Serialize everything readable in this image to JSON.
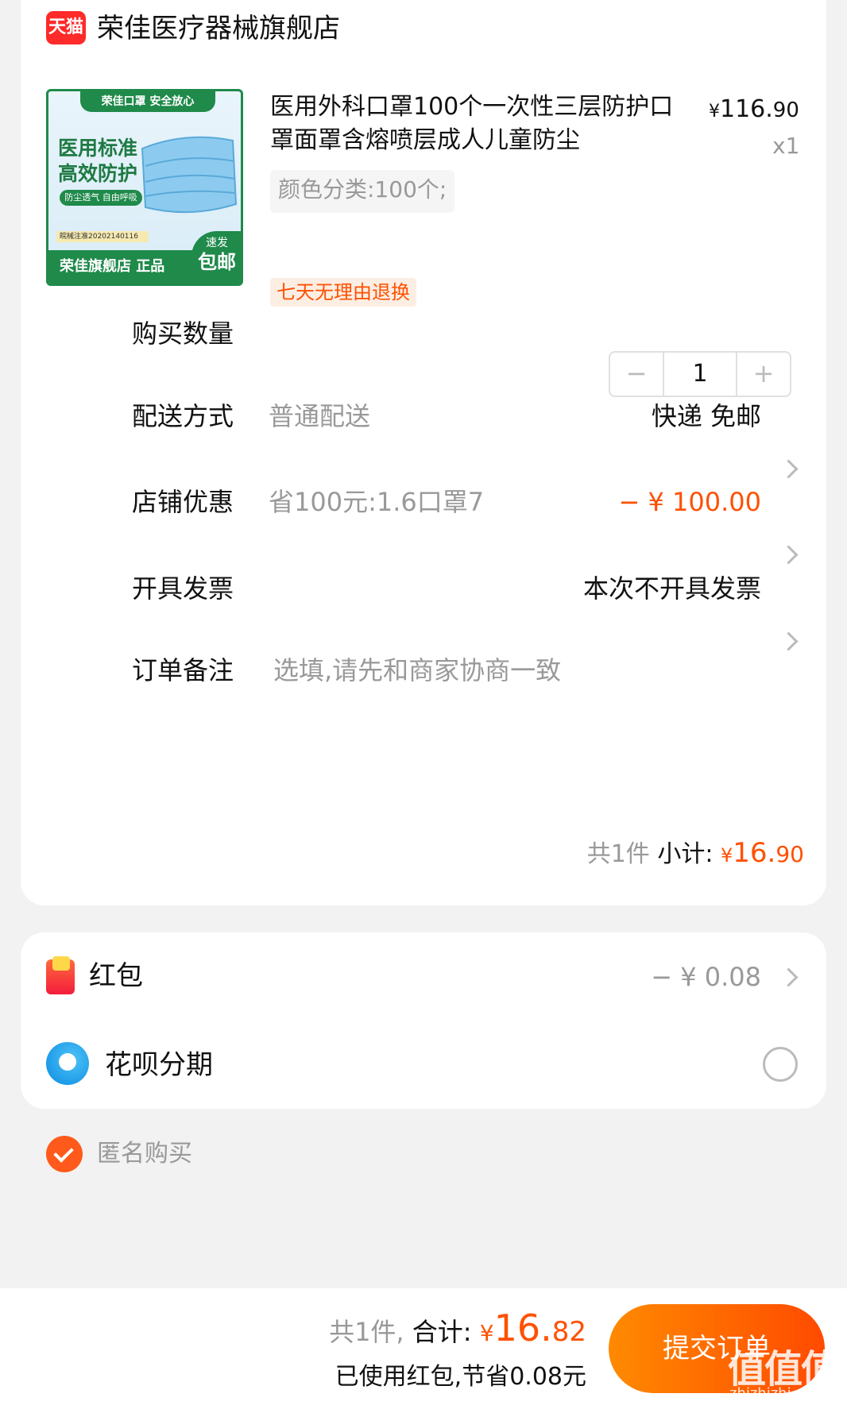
{
  "shop": {
    "badge": "天猫",
    "name": "荣佳医疗器械旗舰店"
  },
  "product": {
    "thumb": {
      "top_band": "荣佳口罩 安全放心",
      "headline1": "医用标准",
      "headline2": "高效防护",
      "sub_band": "防尘透气 自由呼吸",
      "reg_no": "皖械注准20202140116",
      "bottom_text": "荣佳旗舰店 正品",
      "badge_small": "速发",
      "badge_big": "包邮"
    },
    "title": "医用外科口罩100个一次性三层防护口罩面罩含熔喷层成人儿童防尘",
    "price_symbol": "¥",
    "price_int": "116.",
    "price_dec": "90",
    "quantity_text": "x1",
    "sku": "颜色分类:100个;",
    "return_badge": "七天无理由退换"
  },
  "rows": {
    "quantity": {
      "label": "购买数量",
      "minus": "−",
      "value": "1",
      "plus": "+"
    },
    "delivery": {
      "label": "配送方式",
      "value": "普通配送",
      "right": "快递 免邮"
    },
    "coupon": {
      "label": "店铺优惠",
      "value": "省100元:1.6口罩7",
      "right": "− ¥ 100.00"
    },
    "invoice": {
      "label": "开具发票",
      "right": "本次不开具发票"
    },
    "remark": {
      "label": "订单备注",
      "placeholder": "选填,请先和商家协商一致"
    }
  },
  "subtotal": {
    "count": "共1件",
    "label": "小计:",
    "yen": "¥",
    "int": "16.",
    "dec": "90"
  },
  "hongbao": {
    "label": "红包",
    "value": "− ¥ 0.08"
  },
  "huabei": {
    "label": "花呗分期"
  },
  "anonymous": {
    "label": "匿名购买"
  },
  "footer": {
    "count": "共1件,",
    "total_label": "合计:",
    "yen": "¥",
    "int": "16.",
    "dec": "82",
    "saved": "已使用红包,节省0.08元",
    "submit": "提交订单",
    "watermark": "值值值",
    "watermark_url": "zhizhizhi.com"
  }
}
